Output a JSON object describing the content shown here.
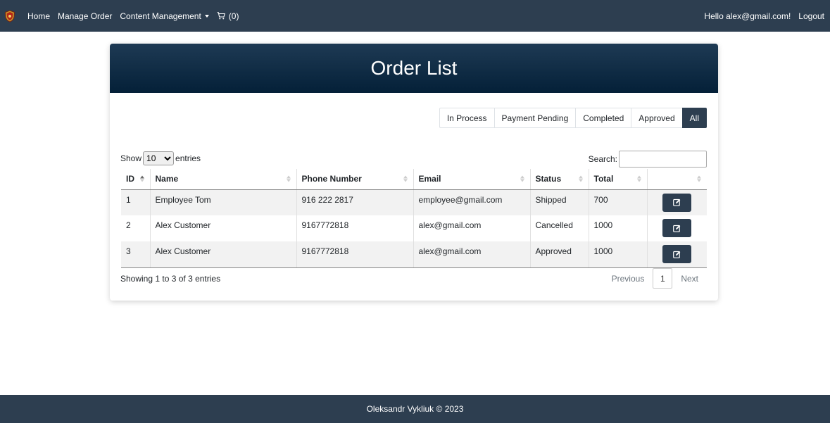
{
  "nav": {
    "logo_icon": "shield-crest-icon",
    "home": "Home",
    "manage_order": "Manage Order",
    "content_management": "Content Management",
    "cart_count": "(0)",
    "greeting": "Hello alex@gmail.com!",
    "logout": "Logout"
  },
  "page": {
    "title": "Order List"
  },
  "filters": [
    {
      "label": "In Process",
      "active": false
    },
    {
      "label": "Payment Pending",
      "active": false
    },
    {
      "label": "Completed",
      "active": false
    },
    {
      "label": "Approved",
      "active": false
    },
    {
      "label": "All",
      "active": true
    }
  ],
  "table": {
    "length_prefix": "Show",
    "length_value": "10",
    "length_suffix": "entries",
    "search_label": "Search:",
    "search_value": "",
    "columns": [
      "ID",
      "Name",
      "Phone Number",
      "Email",
      "Status",
      "Total",
      ""
    ],
    "rows": [
      {
        "id": "1",
        "name": "Employee Tom",
        "phone": "916 222 2817",
        "email": "employee@gmail.com",
        "status": "Shipped",
        "total": "700"
      },
      {
        "id": "2",
        "name": "Alex Customer",
        "phone": "9167772818",
        "email": "alex@gmail.com",
        "status": "Cancelled",
        "total": "1000"
      },
      {
        "id": "3",
        "name": "Alex Customer",
        "phone": "9167772818",
        "email": "alex@gmail.com",
        "status": "Approved",
        "total": "1000"
      }
    ],
    "info": "Showing 1 to 3 of 3 entries",
    "prev": "Previous",
    "page": "1",
    "next": "Next"
  },
  "colors": {
    "navbar": "#2d3e50",
    "header_top": "#1e3a54",
    "header_bottom": "#042038",
    "accent": "#2d3e50"
  },
  "footer": {
    "text": "Oleksandr Vykliuk © 2023"
  }
}
